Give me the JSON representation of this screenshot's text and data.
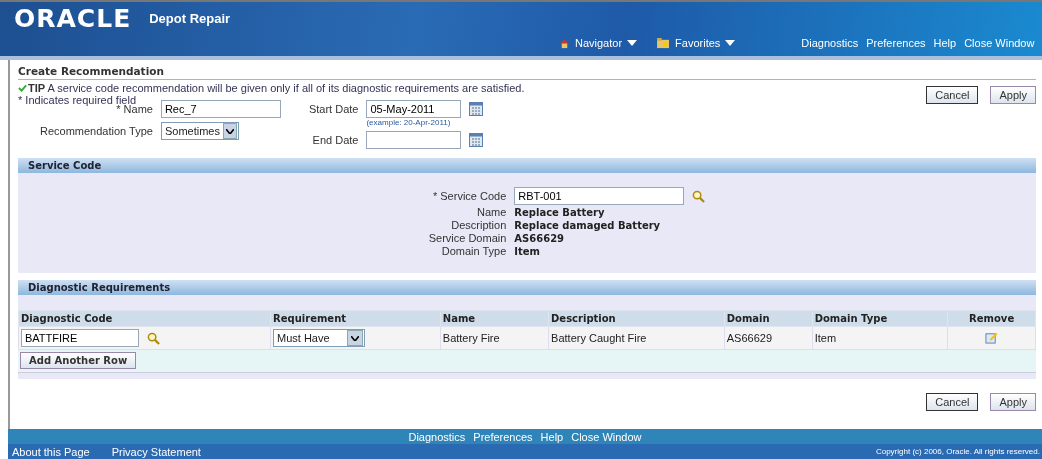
{
  "header": {
    "logo": "ORACLE",
    "app_title": "Depot Repair",
    "menus": [
      {
        "label": "Navigator",
        "kind": "home"
      },
      {
        "label": "Favorites",
        "kind": "folder"
      }
    ],
    "links": [
      "Diagnostics",
      "Preferences",
      "Help",
      "Close Window"
    ]
  },
  "page": {
    "title": "Create Recommendation",
    "tip_label": "TIP",
    "tip": "A service code recommendation will be given only if all of its diagnostic requirements are satisfied.",
    "required_note": "* Indicates required field",
    "buttons": [
      "Cancel",
      "Apply"
    ],
    "name": {
      "label": "* Name",
      "value": "Rec_7"
    },
    "recommendation_type": {
      "label": "Recommendation Type",
      "value": "Sometimes"
    },
    "start_date": {
      "label": "Start Date",
      "value": "05-May-2011",
      "hint": "(example: 20-Apr-2011)"
    },
    "end_date": {
      "label": "End Date"
    }
  },
  "service_code": {
    "title": "Service Code",
    "code": {
      "label": "* Service Code",
      "value": "RBT-001"
    },
    "details": [
      {
        "label": "Name",
        "value": "Replace Battery"
      },
      {
        "label": "Description",
        "value": "Replace damaged Battery"
      },
      {
        "label": "Service Domain",
        "value": "AS66629"
      },
      {
        "label": "Domain Type",
        "value": "Item"
      }
    ]
  },
  "diagnostic_requirements": {
    "title": "Diagnostic Requirements",
    "columns": [
      "Diagnostic Code",
      "Requirement",
      "Name",
      "Description",
      "Domain",
      "Domain Type",
      "Remove"
    ],
    "rows": [
      {
        "code": "BATTFIRE",
        "requirement": "Must Have",
        "name": "Battery Fire",
        "description": "Battery Caught Fire",
        "domain": "AS66629",
        "domain_type": "Item"
      }
    ],
    "add_button": "Add Another Row"
  },
  "bottom_buttons": [
    "Cancel",
    "Apply"
  ],
  "footer": {
    "links": [
      "Diagnostics",
      "Preferences",
      "Help",
      "Close Window"
    ],
    "about": "About this Page",
    "privacy": "Privacy Statement",
    "copyright": "Copyright (c) 2006, Oracle. All rights reserved."
  }
}
